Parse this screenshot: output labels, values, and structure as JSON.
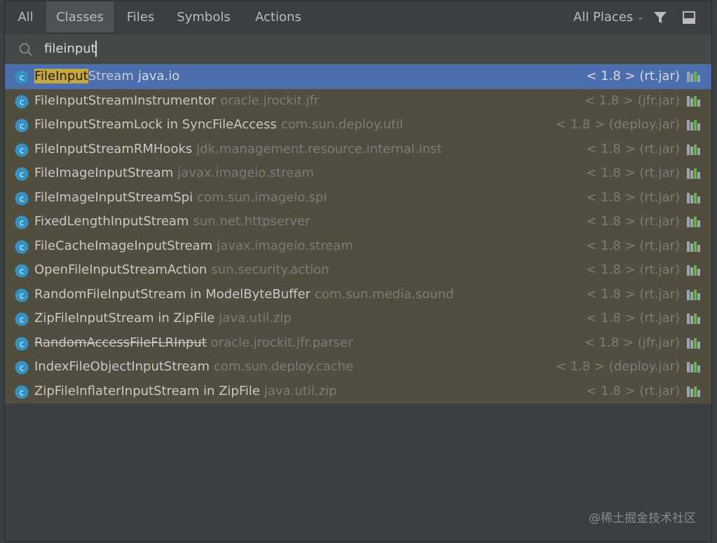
{
  "tabs": [
    {
      "label": "All",
      "active": false
    },
    {
      "label": "Classes",
      "active": true
    },
    {
      "label": "Files",
      "active": false
    },
    {
      "label": "Symbols",
      "active": false
    },
    {
      "label": "Actions",
      "active": false
    }
  ],
  "places": {
    "label": "All Places",
    "icon": "chevron-down-icon"
  },
  "toolbar": {
    "filter_icon": "filter-icon",
    "dock_icon": "dock-window-icon"
  },
  "search": {
    "value": "fileinput",
    "icon": "search-icon"
  },
  "results": [
    {
      "match": "FileInput",
      "rest": "Stream",
      "pkg": "java.io",
      "loc": "< 1.8 > (rt.jar)",
      "selected": true,
      "deprecated": false,
      "icon": "class-icon"
    },
    {
      "match": "",
      "rest": "FileInputStreamInstrumentor",
      "pkg": "oracle.jrockit.jfr",
      "loc": "< 1.8 > (jfr.jar)",
      "selected": false,
      "deprecated": false,
      "icon": "class-icon"
    },
    {
      "match": "",
      "rest": "FileInputStreamLock in SyncFileAccess",
      "pkg": "com.sun.deploy.util",
      "loc": "< 1.8 > (deploy.jar)",
      "selected": false,
      "deprecated": false,
      "icon": "class-icon"
    },
    {
      "match": "",
      "rest": "FileInputStreamRMHooks",
      "pkg": "jdk.management.resource.internal.inst",
      "loc": "< 1.8 > (rt.jar)",
      "selected": false,
      "deprecated": false,
      "icon": "class-icon"
    },
    {
      "match": "",
      "rest": "FileImageInputStream",
      "pkg": "javax.imageio.stream",
      "loc": "< 1.8 > (rt.jar)",
      "selected": false,
      "deprecated": false,
      "icon": "class-icon"
    },
    {
      "match": "",
      "rest": "FileImageInputStreamSpi",
      "pkg": "com.sun.imageio.spi",
      "loc": "< 1.8 > (rt.jar)",
      "selected": false,
      "deprecated": false,
      "icon": "class-icon"
    },
    {
      "match": "",
      "rest": "FixedLengthInputStream",
      "pkg": "sun.net.httpserver",
      "loc": "< 1.8 > (rt.jar)",
      "selected": false,
      "deprecated": false,
      "icon": "class-icon"
    },
    {
      "match": "",
      "rest": "FileCacheImageInputStream",
      "pkg": "javax.imageio.stream",
      "loc": "< 1.8 > (rt.jar)",
      "selected": false,
      "deprecated": false,
      "icon": "class-icon"
    },
    {
      "match": "",
      "rest": "OpenFileInputStreamAction",
      "pkg": "sun.security.action",
      "loc": "< 1.8 > (rt.jar)",
      "selected": false,
      "deprecated": false,
      "icon": "class-icon"
    },
    {
      "match": "",
      "rest": "RandomFileInputStream in ModelByteBuffer",
      "pkg": "com.sun.media.sound",
      "loc": "< 1.8 > (rt.jar)",
      "selected": false,
      "deprecated": false,
      "icon": "class-icon"
    },
    {
      "match": "",
      "rest": "ZipFileInputStream in ZipFile",
      "pkg": "java.util.zip",
      "loc": "< 1.8 > (rt.jar)",
      "selected": false,
      "deprecated": false,
      "icon": "class-icon"
    },
    {
      "match": "",
      "rest": "RandomAccessFileFLRInput",
      "pkg": "oracle.jrockit.jfr.parser",
      "loc": "< 1.8 > (jfr.jar)",
      "selected": false,
      "deprecated": true,
      "icon": "class-icon"
    },
    {
      "match": "",
      "rest": "IndexFileObjectInputStream",
      "pkg": "com.sun.deploy.cache",
      "loc": "< 1.8 > (deploy.jar)",
      "selected": false,
      "deprecated": false,
      "icon": "class-icon"
    },
    {
      "match": "",
      "rest": "ZipFileInflaterInputStream in ZipFile",
      "pkg": "java.util.zip",
      "loc": "< 1.8 > (rt.jar)",
      "selected": false,
      "deprecated": false,
      "icon": "class-icon"
    }
  ],
  "watermark": "@稀土掘金技术社区",
  "colors": {
    "background": "#3c3f41",
    "selection": "#4b6eaf",
    "results_bg": "#514e3f",
    "match_highlight": "#c6a740",
    "class_icon": "#3592c4"
  }
}
